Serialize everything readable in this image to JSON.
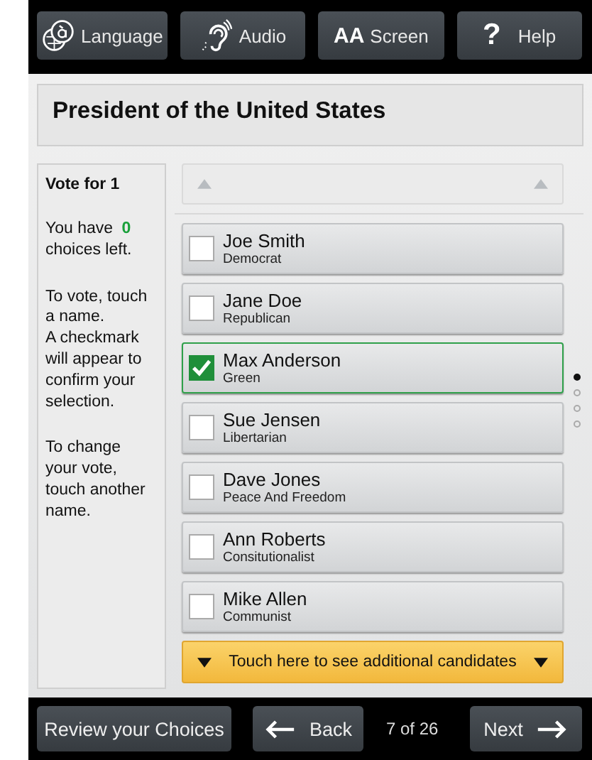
{
  "toolbar": [
    {
      "kind": "language",
      "label": "Language"
    },
    {
      "kind": "audio",
      "label": "Audio"
    },
    {
      "kind": "screen",
      "glyph": "AA",
      "label": "Screen"
    },
    {
      "kind": "help",
      "glyph": "?",
      "label": "Help"
    }
  ],
  "contest": {
    "title": "President of the United States"
  },
  "sidebar": {
    "vote_for": "Vote for 1",
    "choices_left": {
      "before": "You have",
      "count": "0",
      "after": "choices left."
    },
    "paragraphs": [
      [
        "To vote, touch a name.",
        "A checkmark will appear to confirm your selection."
      ],
      [
        "To change your vote, touch another name."
      ]
    ]
  },
  "candidates": [
    {
      "name": "Joe Smith",
      "party": "Democrat",
      "selected": false
    },
    {
      "name": "Jane Doe",
      "party": "Republican",
      "selected": false
    },
    {
      "name": "Max Anderson",
      "party": "Green",
      "selected": true
    },
    {
      "name": "Sue Jensen",
      "party": "Libertarian",
      "selected": false
    },
    {
      "name": "Dave Jones",
      "party": "Peace And Freedom",
      "selected": false
    },
    {
      "name": "Ann Roberts",
      "party": "Consitutionalist",
      "selected": false
    },
    {
      "name": "Mike Allen",
      "party": "Communist",
      "selected": false
    }
  ],
  "pages": [
    {
      "selected": true
    },
    {
      "selected": false
    },
    {
      "selected": false
    },
    {
      "selected": false
    }
  ],
  "more_button": {
    "label": "Touch here to see additional candidates"
  },
  "footer": {
    "review": "Review your Choices",
    "back": "Back",
    "position": "7 of 26",
    "next": "Next"
  }
}
